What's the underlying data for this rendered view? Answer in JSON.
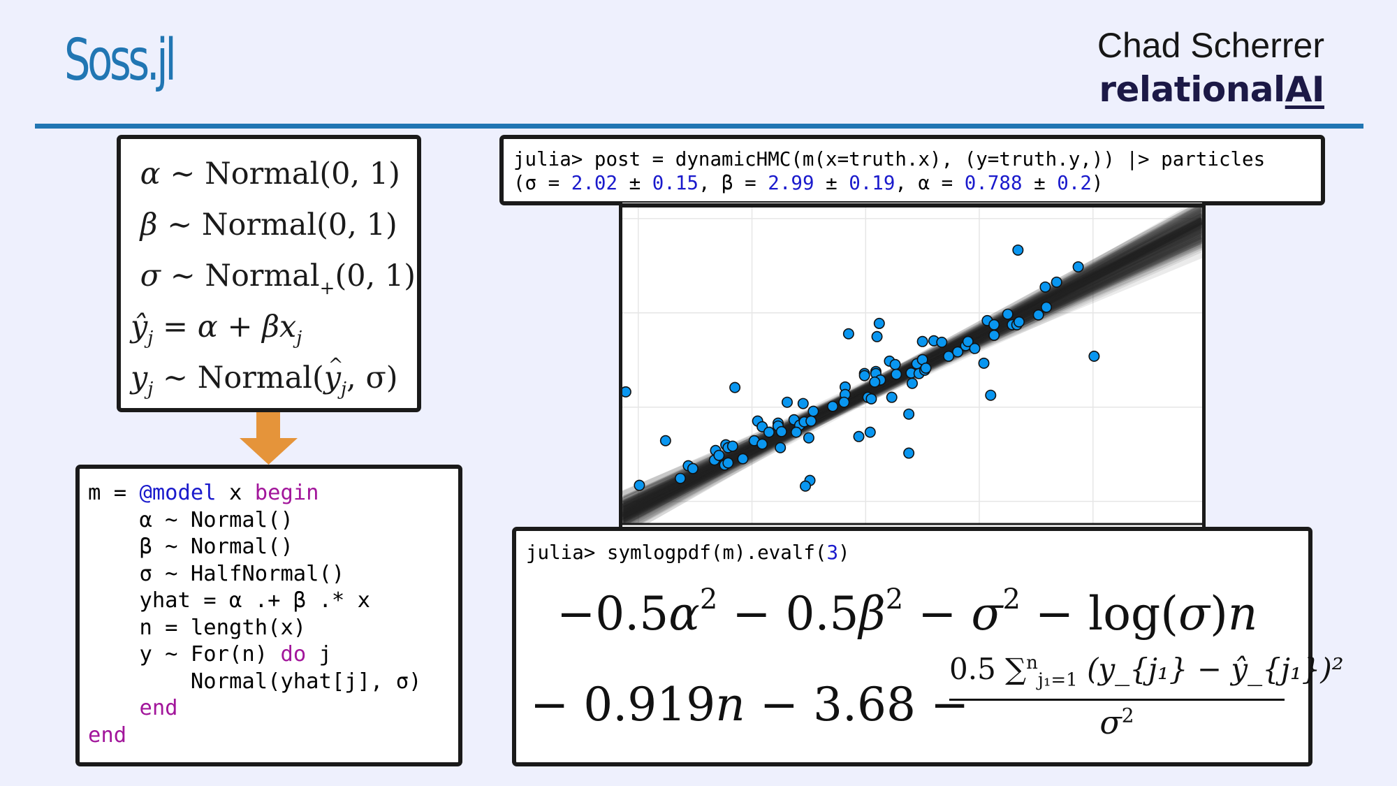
{
  "header": {
    "title": "Soss.jl",
    "author": "Chad Scherrer",
    "brand_prefix": "relational",
    "brand_suffix": "AI"
  },
  "colors": {
    "background": "#eef0fd",
    "title_blue": "#2176b3",
    "brand_navy": "#1c1946",
    "arrow_orange": "#e5943a",
    "keyword_purple": "#a2169b",
    "number_blue": "#1a1acc",
    "point_fill": "#0996f0",
    "band_gray": "#333333"
  },
  "math_model": {
    "lines": [
      {
        "lhs": "α",
        "rel": "∼",
        "rhs": "Normal(0, 1)"
      },
      {
        "lhs": "β",
        "rel": "∼",
        "rhs": "Normal(0, 1)"
      },
      {
        "lhs": "σ",
        "rel": "∼",
        "rhs_name": "Normal",
        "rhs_sub": "+",
        "rhs_args": "(0, 1)"
      },
      {
        "lhs": "ŷ",
        "lhs_sub": "j",
        "rel": "=",
        "rhs": "α + βx",
        "rhs_sub": "j"
      },
      {
        "lhs": "y",
        "lhs_sub": "j",
        "rel": "∼",
        "rhs_name": "Normal(",
        "rhs_hat": "y",
        "rhs_hat_sub": "j",
        "rhs_tail": ", σ)"
      }
    ]
  },
  "code": {
    "lines": [
      [
        {
          "t": "m = "
        },
        {
          "t": "@model",
          "c": "mac"
        },
        {
          "t": " x "
        },
        {
          "t": "begin",
          "c": "kw"
        }
      ],
      [
        {
          "t": "    α ~ Normal()"
        }
      ],
      [
        {
          "t": "    β ~ Normal()"
        }
      ],
      [
        {
          "t": "    σ ~ HalfNormal()"
        }
      ],
      [
        {
          "t": "    yhat = α .+ β .* x"
        }
      ],
      [
        {
          "t": "    n = length(x)"
        }
      ],
      [
        {
          "t": "    y ~ For(n) "
        },
        {
          "t": "do",
          "c": "kw"
        },
        {
          "t": " j"
        }
      ],
      [
        {
          "t": "        Normal(yhat[j], σ)"
        }
      ],
      [
        {
          "t": "    "
        },
        {
          "t": "end",
          "c": "kw"
        }
      ],
      [
        {
          "t": "end",
          "c": "kw"
        }
      ]
    ]
  },
  "repl_top": {
    "lines": [
      [
        {
          "t": "julia> post = dynamicHMC(m(x=truth.x), (y=truth.y,)) |> particles"
        }
      ],
      [
        {
          "t": "(σ = "
        },
        {
          "t": "2.02",
          "c": "num"
        },
        {
          "t": " ± "
        },
        {
          "t": "0.15",
          "c": "num"
        },
        {
          "t": ", β = "
        },
        {
          "t": "2.99",
          "c": "num"
        },
        {
          "t": " ± "
        },
        {
          "t": "0.19",
          "c": "num"
        },
        {
          "t": ", α = "
        },
        {
          "t": "0.788",
          "c": "num"
        },
        {
          "t": " ± "
        },
        {
          "t": "0.2",
          "c": "num"
        },
        {
          "t": ")"
        }
      ]
    ]
  },
  "repl_bottom": {
    "prompt": [
      {
        "t": "julia> symlogpdf(m).evalf("
      },
      {
        "t": "3",
        "c": "num"
      },
      {
        "t": ")"
      }
    ],
    "expr_line1": [
      {
        "t": "−0.5"
      },
      {
        "t": "α",
        "i": true
      },
      {
        "sup": "2"
      },
      {
        "t": " − 0.5"
      },
      {
        "t": "β",
        "i": true
      },
      {
        "sup": "2"
      },
      {
        "t": " − "
      },
      {
        "t": "σ",
        "i": true
      },
      {
        "sup": "2"
      },
      {
        "t": " − log("
      },
      {
        "t": "σ",
        "i": true
      },
      {
        "t": ")"
      },
      {
        "t": "n",
        "i": true
      }
    ],
    "expr_line2": [
      {
        "t": "− 0.919"
      },
      {
        "t": "n",
        "i": true
      },
      {
        "t": " − 3.68 −"
      }
    ],
    "fraction_numerator": "0.5 ∑",
    "sum_upper": "n",
    "sum_lower": "j₁=1",
    "sum_body": "(y_{j₁} − ŷ_{j₁})²",
    "fraction_denominator": "σ",
    "denominator_power": "2"
  },
  "chart_data": {
    "type": "scatter",
    "title": "",
    "xlabel": "",
    "ylabel": "",
    "xlim": [
      -2.14,
      2.96
    ],
    "ylim": [
      -6.2,
      10.7
    ],
    "xticks": [
      -2,
      -1,
      0,
      1,
      2
    ],
    "yticks": [
      -5,
      0,
      5,
      10
    ],
    "tick_labels_visible": false,
    "grid": true,
    "legend": "none",
    "posterior_lines": {
      "description": "posterior regression lines y = α + βx",
      "alpha_mean": 0.788,
      "alpha_sd": 0.2,
      "beta_mean": 2.99,
      "beta_sd": 0.19,
      "count": 120
    },
    "points": [
      [
        -2.11,
        0.81
      ],
      [
        -1.99,
        -4.15
      ],
      [
        -1.76,
        -1.78
      ],
      [
        -1.63,
        -3.78
      ],
      [
        -1.56,
        -3.11
      ],
      [
        -1.52,
        -3.26
      ],
      [
        -1.33,
        -2.81
      ],
      [
        -1.32,
        -2.3
      ],
      [
        -1.29,
        -2.56
      ],
      [
        -1.24,
        -3.07
      ],
      [
        -1.21,
        -2.96
      ],
      [
        -1.23,
        -2.0
      ],
      [
        -1.21,
        -2.15
      ],
      [
        -1.17,
        -2.07
      ],
      [
        -1.15,
        1.04
      ],
      [
        -1.08,
        -2.74
      ],
      [
        -0.98,
        -1.78
      ],
      [
        -0.91,
        -1.96
      ],
      [
        -0.95,
        -0.74
      ],
      [
        -0.91,
        -1.04
      ],
      [
        -0.85,
        -1.33
      ],
      [
        -0.77,
        -0.85
      ],
      [
        -0.77,
        -1.0
      ],
      [
        -0.74,
        -1.3
      ],
      [
        -0.75,
        -2.15
      ],
      [
        -0.69,
        0.26
      ],
      [
        -0.55,
        0.19
      ],
      [
        -0.63,
        -0.67
      ],
      [
        -0.58,
        -0.96
      ],
      [
        -0.54,
        -0.78
      ],
      [
        -0.48,
        -0.74
      ],
      [
        -0.46,
        -0.22
      ],
      [
        -0.61,
        -1.33
      ],
      [
        -0.5,
        -1.63
      ],
      [
        -0.49,
        -3.89
      ],
      [
        -0.53,
        -4.19
      ],
      [
        -0.29,
        0.04
      ],
      [
        -0.18,
        1.07
      ],
      [
        -0.18,
        0.67
      ],
      [
        -0.19,
        0.26
      ],
      [
        -0.15,
        3.89
      ],
      [
        0.12,
        4.44
      ],
      [
        0.1,
        3.74
      ],
      [
        -0.01,
        1.78
      ],
      [
        -0.01,
        1.67
      ],
      [
        0.09,
        1.89
      ],
      [
        0.09,
        1.78
      ],
      [
        0.13,
        1.44
      ],
      [
        0.08,
        1.33
      ],
      [
        0.02,
        0.52
      ],
      [
        0.05,
        0.44
      ],
      [
        -0.06,
        -1.56
      ],
      [
        0.04,
        -1.33
      ],
      [
        0.21,
        2.44
      ],
      [
        0.26,
        2.26
      ],
      [
        0.27,
        1.74
      ],
      [
        0.23,
        0.52
      ],
      [
        0.38,
        -0.37
      ],
      [
        0.38,
        -2.44
      ],
      [
        0.4,
        1.81
      ],
      [
        0.41,
        1.26
      ],
      [
        0.45,
        2.3
      ],
      [
        0.5,
        2.52
      ],
      [
        0.47,
        1.78
      ],
      [
        0.52,
        1.96
      ],
      [
        0.53,
        2.07
      ],
      [
        0.5,
        3.48
      ],
      [
        0.6,
        3.52
      ],
      [
        0.67,
        3.44
      ],
      [
        0.73,
        2.7
      ],
      [
        0.81,
        2.93
      ],
      [
        0.88,
        3.26
      ],
      [
        0.9,
        3.48
      ],
      [
        0.96,
        3.11
      ],
      [
        1.04,
        2.33
      ],
      [
        1.1,
        0.63
      ],
      [
        1.07,
        4.59
      ],
      [
        1.13,
        4.37
      ],
      [
        1.13,
        3.81
      ],
      [
        1.25,
        4.93
      ],
      [
        1.29,
        4.37
      ],
      [
        1.33,
        4.37
      ],
      [
        1.35,
        4.52
      ],
      [
        1.52,
        4.89
      ],
      [
        1.59,
        5.3
      ],
      [
        1.34,
        8.33
      ],
      [
        1.87,
        7.44
      ],
      [
        1.68,
        6.63
      ],
      [
        1.58,
        6.37
      ],
      [
        2.01,
        2.7
      ]
    ]
  }
}
